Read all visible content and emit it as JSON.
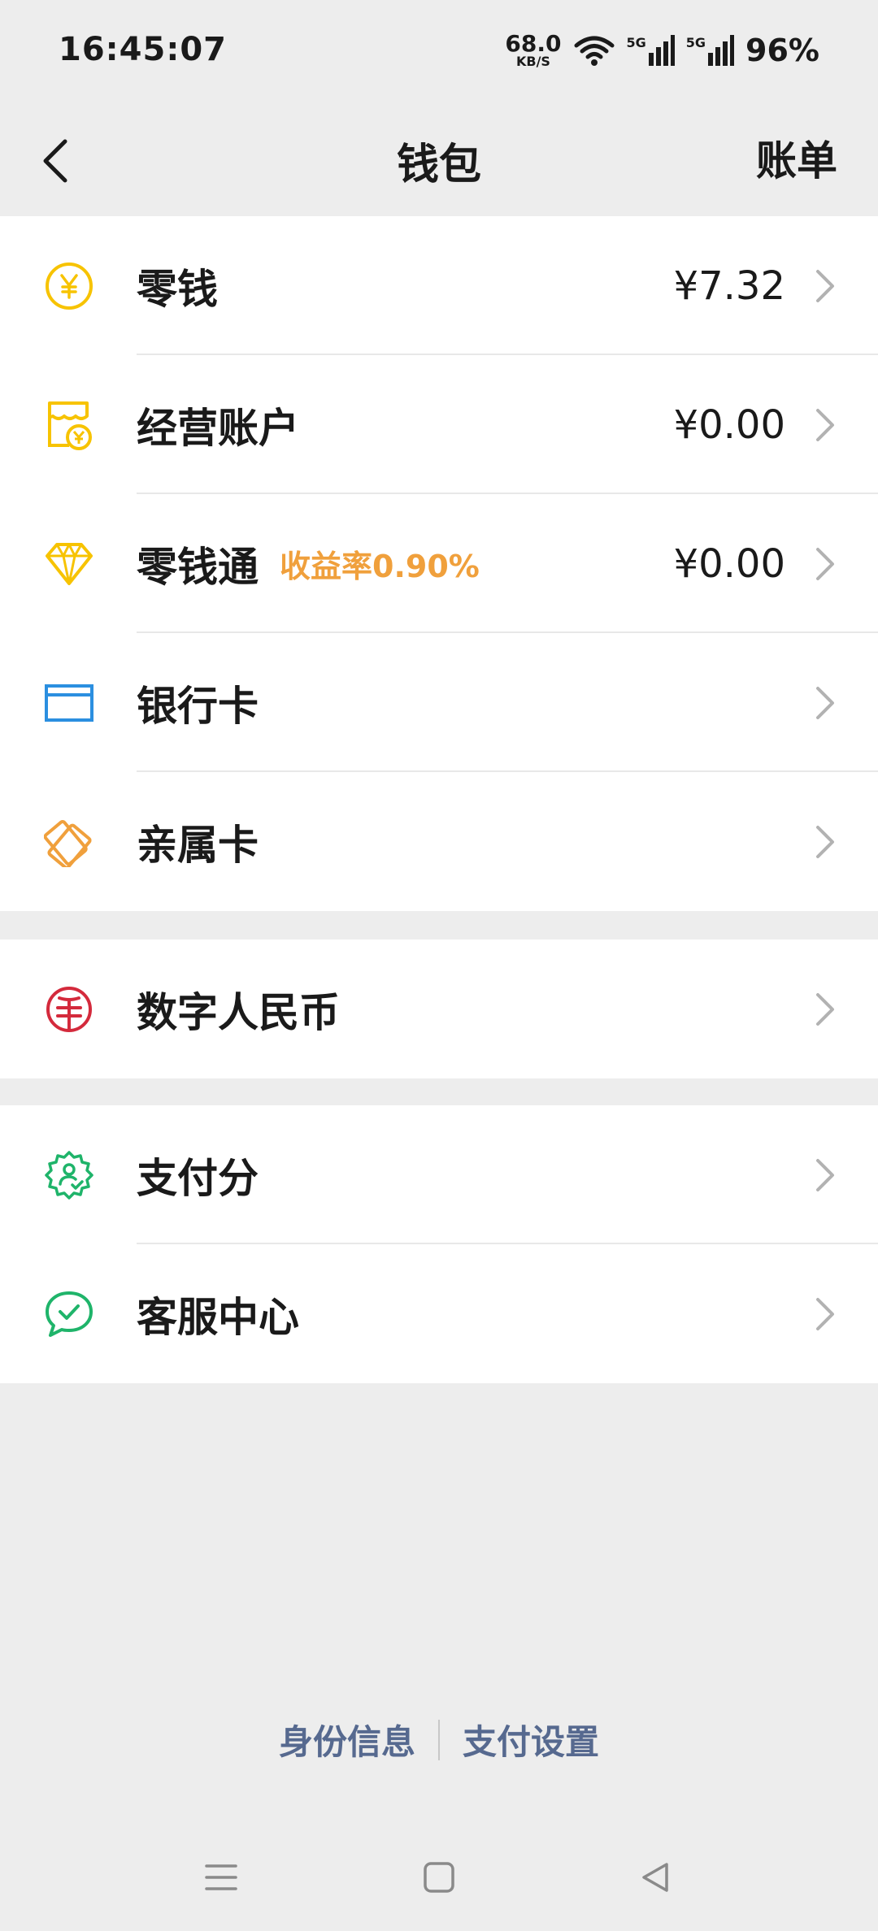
{
  "status": {
    "time": "16:45:07",
    "net_speed": "68.0",
    "net_unit": "KB/S",
    "signal1": "5G",
    "signal2": "5G",
    "battery": "96%"
  },
  "nav": {
    "title": "钱包",
    "right_action": "账单"
  },
  "groups": [
    {
      "items": [
        {
          "label": "零钱",
          "amount": "¥7.32",
          "icon": "yuan-coin-icon",
          "color": "#f7c300"
        },
        {
          "label": "经营账户",
          "amount": "¥0.00",
          "icon": "shop-account-icon",
          "color": "#f7c300"
        },
        {
          "label": "零钱通",
          "badge": "收益率0.90%",
          "amount": "¥0.00",
          "icon": "diamond-icon",
          "color": "#f7c300"
        },
        {
          "label": "银行卡",
          "icon": "bank-card-icon",
          "color": "#2b8fe0"
        },
        {
          "label": "亲属卡",
          "icon": "family-card-icon",
          "color": "#f0a03c"
        }
      ]
    },
    {
      "items": [
        {
          "label": "数字人民币",
          "icon": "digital-rmb-icon",
          "color": "#d42a3c"
        }
      ]
    },
    {
      "items": [
        {
          "label": "支付分",
          "icon": "pay-score-icon",
          "color": "#1fb46a"
        },
        {
          "label": "客服中心",
          "icon": "customer-service-icon",
          "color": "#1fb46a"
        }
      ]
    }
  ],
  "footer": {
    "link1": "身份信息",
    "link2": "支付设置"
  },
  "colors": {
    "background": "#ededed",
    "badge": "#f0a03c",
    "footer_link": "#56698f"
  }
}
